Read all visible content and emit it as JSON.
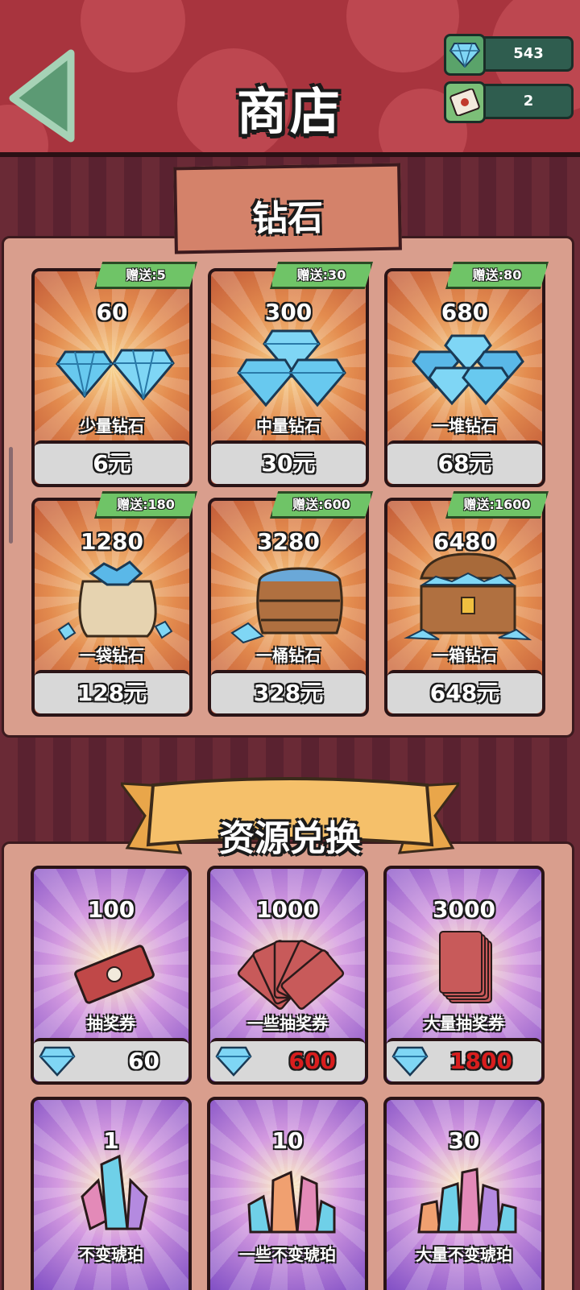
{
  "header": {
    "title": "商店",
    "diamond_count": "543",
    "ticket_count": "2"
  },
  "sections": {
    "diamonds_title": "钻石",
    "exchange_title": "资源兑换"
  },
  "diamond_packs": [
    {
      "amount": "60",
      "bonus": "赠送:5",
      "name": "少量钻石",
      "price": "6元",
      "icon": "two-diamonds-icon"
    },
    {
      "amount": "300",
      "bonus": "赠送:30",
      "name": "中量钻石",
      "price": "30元",
      "icon": "three-diamonds-icon"
    },
    {
      "amount": "680",
      "bonus": "赠送:80",
      "name": "一堆钻石",
      "price": "68元",
      "icon": "diamond-pile-icon"
    },
    {
      "amount": "1280",
      "bonus": "赠送:180",
      "name": "一袋钻石",
      "price": "128元",
      "icon": "diamond-sack-icon"
    },
    {
      "amount": "3280",
      "bonus": "赠送:600",
      "name": "一桶钻石",
      "price": "328元",
      "icon": "diamond-barrel-icon"
    },
    {
      "amount": "6480",
      "bonus": "赠送:1600",
      "name": "一箱钻石",
      "price": "648元",
      "icon": "treasure-chest-icon"
    }
  ],
  "exchange_items": [
    {
      "amount": "100",
      "name": "抽奖券",
      "cost": "60",
      "cost_red": false,
      "icon": "lottery-ticket-icon"
    },
    {
      "amount": "1000",
      "name": "一些抽奖券",
      "cost": "600",
      "cost_red": true,
      "icon": "ticket-fan-icon"
    },
    {
      "amount": "3000",
      "name": "大量抽奖券",
      "cost": "1800",
      "cost_red": true,
      "icon": "ticket-stack-icon"
    },
    {
      "amount": "1",
      "name": "不变琥珀",
      "icon": "amber-crystal-icon"
    },
    {
      "amount": "10",
      "name": "一些不变琥珀",
      "icon": "amber-cluster-icon"
    },
    {
      "amount": "30",
      "name": "大量不变琥珀",
      "icon": "amber-pile-icon"
    }
  ],
  "colors": {
    "header_bg": "#a8343e",
    "bonus_green": "#6fc467",
    "price_red": "#d91e1e",
    "back_green": "#5c9a74"
  }
}
